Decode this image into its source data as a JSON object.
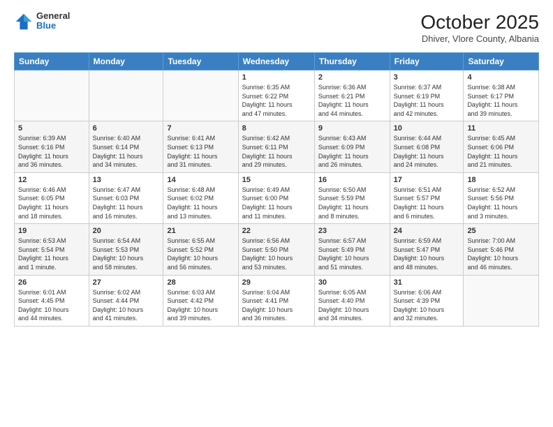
{
  "header": {
    "logo": {
      "general": "General",
      "blue": "Blue"
    },
    "title": "October 2025",
    "subtitle": "Dhiver, Vlore County, Albania"
  },
  "calendar": {
    "days_of_week": [
      "Sunday",
      "Monday",
      "Tuesday",
      "Wednesday",
      "Thursday",
      "Friday",
      "Saturday"
    ],
    "weeks": [
      [
        {
          "day": "",
          "info": ""
        },
        {
          "day": "",
          "info": ""
        },
        {
          "day": "",
          "info": ""
        },
        {
          "day": "1",
          "info": "Sunrise: 6:35 AM\nSunset: 6:22 PM\nDaylight: 11 hours\nand 47 minutes."
        },
        {
          "day": "2",
          "info": "Sunrise: 6:36 AM\nSunset: 6:21 PM\nDaylight: 11 hours\nand 44 minutes."
        },
        {
          "day": "3",
          "info": "Sunrise: 6:37 AM\nSunset: 6:19 PM\nDaylight: 11 hours\nand 42 minutes."
        },
        {
          "day": "4",
          "info": "Sunrise: 6:38 AM\nSunset: 6:17 PM\nDaylight: 11 hours\nand 39 minutes."
        }
      ],
      [
        {
          "day": "5",
          "info": "Sunrise: 6:39 AM\nSunset: 6:16 PM\nDaylight: 11 hours\nand 36 minutes."
        },
        {
          "day": "6",
          "info": "Sunrise: 6:40 AM\nSunset: 6:14 PM\nDaylight: 11 hours\nand 34 minutes."
        },
        {
          "day": "7",
          "info": "Sunrise: 6:41 AM\nSunset: 6:13 PM\nDaylight: 11 hours\nand 31 minutes."
        },
        {
          "day": "8",
          "info": "Sunrise: 6:42 AM\nSunset: 6:11 PM\nDaylight: 11 hours\nand 29 minutes."
        },
        {
          "day": "9",
          "info": "Sunrise: 6:43 AM\nSunset: 6:09 PM\nDaylight: 11 hours\nand 26 minutes."
        },
        {
          "day": "10",
          "info": "Sunrise: 6:44 AM\nSunset: 6:08 PM\nDaylight: 11 hours\nand 24 minutes."
        },
        {
          "day": "11",
          "info": "Sunrise: 6:45 AM\nSunset: 6:06 PM\nDaylight: 11 hours\nand 21 minutes."
        }
      ],
      [
        {
          "day": "12",
          "info": "Sunrise: 6:46 AM\nSunset: 6:05 PM\nDaylight: 11 hours\nand 18 minutes."
        },
        {
          "day": "13",
          "info": "Sunrise: 6:47 AM\nSunset: 6:03 PM\nDaylight: 11 hours\nand 16 minutes."
        },
        {
          "day": "14",
          "info": "Sunrise: 6:48 AM\nSunset: 6:02 PM\nDaylight: 11 hours\nand 13 minutes."
        },
        {
          "day": "15",
          "info": "Sunrise: 6:49 AM\nSunset: 6:00 PM\nDaylight: 11 hours\nand 11 minutes."
        },
        {
          "day": "16",
          "info": "Sunrise: 6:50 AM\nSunset: 5:59 PM\nDaylight: 11 hours\nand 8 minutes."
        },
        {
          "day": "17",
          "info": "Sunrise: 6:51 AM\nSunset: 5:57 PM\nDaylight: 11 hours\nand 6 minutes."
        },
        {
          "day": "18",
          "info": "Sunrise: 6:52 AM\nSunset: 5:56 PM\nDaylight: 11 hours\nand 3 minutes."
        }
      ],
      [
        {
          "day": "19",
          "info": "Sunrise: 6:53 AM\nSunset: 5:54 PM\nDaylight: 11 hours\nand 1 minute."
        },
        {
          "day": "20",
          "info": "Sunrise: 6:54 AM\nSunset: 5:53 PM\nDaylight: 10 hours\nand 58 minutes."
        },
        {
          "day": "21",
          "info": "Sunrise: 6:55 AM\nSunset: 5:52 PM\nDaylight: 10 hours\nand 56 minutes."
        },
        {
          "day": "22",
          "info": "Sunrise: 6:56 AM\nSunset: 5:50 PM\nDaylight: 10 hours\nand 53 minutes."
        },
        {
          "day": "23",
          "info": "Sunrise: 6:57 AM\nSunset: 5:49 PM\nDaylight: 10 hours\nand 51 minutes."
        },
        {
          "day": "24",
          "info": "Sunrise: 6:59 AM\nSunset: 5:47 PM\nDaylight: 10 hours\nand 48 minutes."
        },
        {
          "day": "25",
          "info": "Sunrise: 7:00 AM\nSunset: 5:46 PM\nDaylight: 10 hours\nand 46 minutes."
        }
      ],
      [
        {
          "day": "26",
          "info": "Sunrise: 6:01 AM\nSunset: 4:45 PM\nDaylight: 10 hours\nand 44 minutes."
        },
        {
          "day": "27",
          "info": "Sunrise: 6:02 AM\nSunset: 4:44 PM\nDaylight: 10 hours\nand 41 minutes."
        },
        {
          "day": "28",
          "info": "Sunrise: 6:03 AM\nSunset: 4:42 PM\nDaylight: 10 hours\nand 39 minutes."
        },
        {
          "day": "29",
          "info": "Sunrise: 6:04 AM\nSunset: 4:41 PM\nDaylight: 10 hours\nand 36 minutes."
        },
        {
          "day": "30",
          "info": "Sunrise: 6:05 AM\nSunset: 4:40 PM\nDaylight: 10 hours\nand 34 minutes."
        },
        {
          "day": "31",
          "info": "Sunrise: 6:06 AM\nSunset: 4:39 PM\nDaylight: 10 hours\nand 32 minutes."
        },
        {
          "day": "",
          "info": ""
        }
      ]
    ]
  }
}
